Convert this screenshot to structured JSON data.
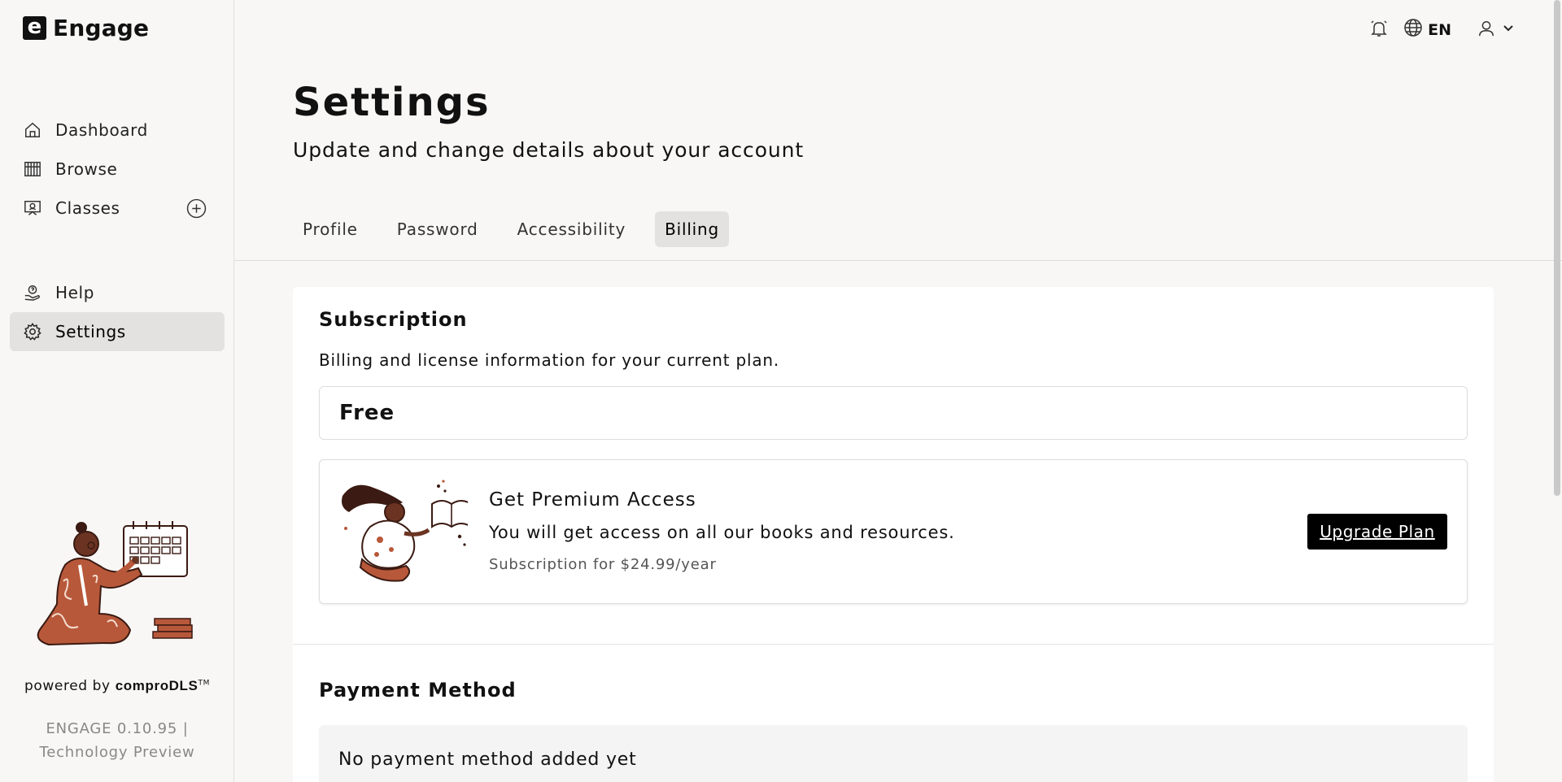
{
  "brand": {
    "logo_letter": "e",
    "name": "Engage"
  },
  "sidebar": {
    "items": [
      {
        "label": "Dashboard",
        "icon": "home-icon"
      },
      {
        "label": "Browse",
        "icon": "browse-icon"
      },
      {
        "label": "Classes",
        "icon": "classes-icon"
      },
      {
        "label": "Help",
        "icon": "help-icon"
      },
      {
        "label": "Settings",
        "icon": "gear-icon",
        "active": true
      }
    ],
    "powered_prefix": "powered by",
    "powered_brand": "comproDLS",
    "powered_tm": "TM",
    "version_line1": "ENGAGE 0.10.95 |",
    "version_line2": "Technology Preview"
  },
  "topbar": {
    "language": "EN"
  },
  "header": {
    "title": "Settings",
    "subtitle": "Update and change details about your account"
  },
  "tabs": [
    {
      "label": "Profile"
    },
    {
      "label": "Password"
    },
    {
      "label": "Accessibility"
    },
    {
      "label": "Billing",
      "active": true
    }
  ],
  "subscription": {
    "title": "Subscription",
    "description": "Billing and license information for your current plan.",
    "plan": "Free",
    "premium_title": "Get Premium Access",
    "premium_desc": "You will get access on all our books and resources.",
    "premium_price": "Subscription for $24.99/year",
    "upgrade_label": "Upgrade Plan"
  },
  "payment": {
    "title": "Payment Method",
    "empty_text": "No payment method added yet"
  },
  "colors": {
    "accent": "#000000",
    "background": "#f8f7f6",
    "illustration": "#b8583a",
    "illustration_dark": "#3a1a12"
  }
}
